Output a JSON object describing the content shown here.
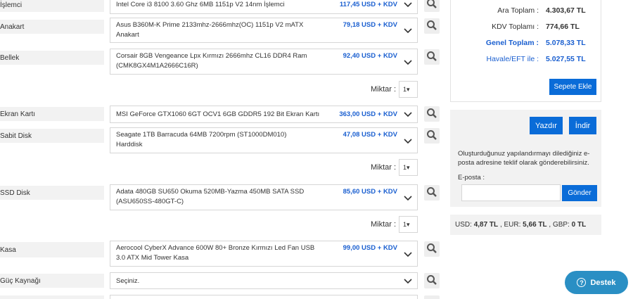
{
  "components": [
    {
      "label": "İşlemci",
      "product": "Intel Core i3 8100 3.60 Ghz 6MB 1151p V2 14nm İşlemci",
      "price": "117,45 USD + KDV"
    },
    {
      "label": "Anakart",
      "product": "Asus B360M-K Prime 2133mhz-2666mhz(OC) 1151p V2 mATX Anakart",
      "price": "79,18 USD + KDV"
    },
    {
      "label": "Bellek",
      "product": "Corsair 8GB Vengeance Lpx Kırmızı 2666mhz CL16 DDR4 Ram (CMK8GX4M1A2666C16R)",
      "price": "92,40 USD + KDV"
    },
    {
      "label": "Ekran Kartı",
      "product": "MSI GeForce GTX1060 6GT OCV1 6GB GDDR5 192 Bit Ekran Kartı",
      "price": "363,00 USD + KDV"
    },
    {
      "label": "Sabit Disk",
      "product": "Seagate 1TB Barracuda 64MB 7200rpm (ST1000DM010) Harddisk",
      "price": "47,08 USD + KDV"
    },
    {
      "label": "SSD Disk",
      "product": "Adata 480GB SU650 Okuma 520MB-Yazma 450MB SATA SSD (ASU650SS-480GT-C)",
      "price": "85,60 USD + KDV"
    },
    {
      "label": "Kasa",
      "product": "Aerocool CyberX Advance 600W 80+ Bronze Kırmızı Led Fan USB 3.0 ATX Mid Tower Kasa",
      "price": "99,00 USD + KDV"
    },
    {
      "label": "Güç Kaynağı",
      "product": "Seçiniz.",
      "price": ""
    }
  ],
  "quantity": {
    "label": "Miktar :",
    "value": "1▾"
  },
  "summary": {
    "subtotal_label": "Ara Toplam :",
    "subtotal": "4.303,67 TL",
    "tax_label": "KDV Toplamı :",
    "tax": "774,66 TL",
    "total_label": "Genel Toplam :",
    "total": "5.078,33 TL",
    "transfer_label": "Havale/EFT ile :",
    "transfer": "5.027,55 TL",
    "add_to_cart": "Sepete Ekle"
  },
  "actions": {
    "print": "Yazdır",
    "download": "İndir",
    "note": "Oluşturduğunuz yapılandırmayı dilediğiniz e-posta adresine teklif olarak gönderebilirsiniz.",
    "email_label": "E-posta :",
    "email_value": "",
    "send": "Gönder"
  },
  "fx": {
    "usd_label": "USD:",
    "usd": "4,87 TL",
    "eur_label": ", EUR:",
    "eur": "5,66 TL",
    "gbp_label": ", GBP:",
    "gbp": "0 TL"
  },
  "support": {
    "label": "Destek"
  },
  "colors": {
    "accent": "#0a6cd8",
    "price": "#1a5fd0",
    "support": "#2a8fc4"
  }
}
